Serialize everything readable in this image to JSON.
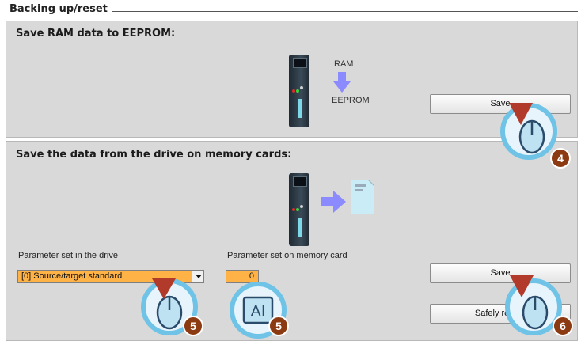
{
  "header": {
    "title": "Backing up/reset"
  },
  "eeprom_section": {
    "title": "Save RAM data to EEPROM:",
    "ram_label": "RAM",
    "eeprom_label": "EEPROM",
    "save_label": "Save"
  },
  "memcard_section": {
    "title": "Save the data from the drive on memory cards:",
    "param_drive_label": "Parameter set in the drive",
    "param_drive_value": "[0] Source/target standard",
    "param_card_label": "Parameter set on memory card",
    "param_card_value": "0",
    "save_label": "Save",
    "safely_remove_label": "Safely remov"
  },
  "callouts": [
    {
      "number": "4"
    },
    {
      "number": "5"
    },
    {
      "number": "5"
    },
    {
      "number": "6"
    }
  ],
  "colors": {
    "panel_bg": "#d9d9d9",
    "field_highlight": "#ffb347",
    "arrow_blue": "#8b8bff",
    "badge": "#8b3a12",
    "callout_blue": "#6fc3e6"
  }
}
